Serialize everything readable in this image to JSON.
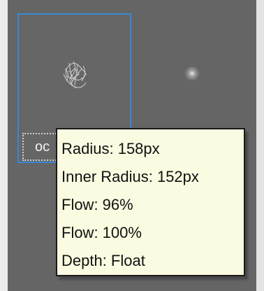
{
  "brush_tile": {
    "name_label": "oc",
    "selected": true,
    "accent_color": "#3a87d6"
  },
  "tooltip": {
    "lines": [
      "Radius: 158px",
      "Inner Radius: 152px",
      "Flow: 96%",
      "Flow: 100%",
      "Depth: Float"
    ],
    "background_color": "#fbfbe1"
  },
  "icons": {
    "brush_preview": "brush-stroke-icon",
    "soft_dot": "soft-brush-dot-icon"
  }
}
